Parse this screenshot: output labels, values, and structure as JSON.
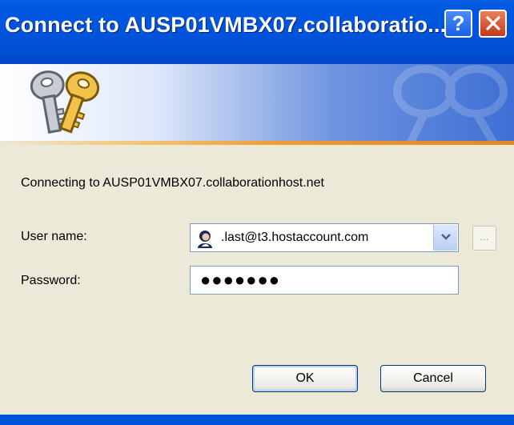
{
  "window": {
    "title": "Connect to AUSP01VMBX07.collaboratio...",
    "help_glyph": "?",
    "colors": {
      "titlebar": "#0054dc",
      "dialog_bg": "#ece9d8",
      "banner_accent": "#f29a2e"
    }
  },
  "icons": [
    "keys-icon",
    "help-icon",
    "close-icon",
    "user-avatar-icon",
    "chevron-down-icon",
    "watermark-icon"
  ],
  "body": {
    "connecting_text": "Connecting to AUSP01VMBX07.collaborationhost.net",
    "user_label": "User name:",
    "user_value": ".last@t3.hostaccount.com",
    "browse_label": "...",
    "password_label": "Password:",
    "password_mask": "●●●●●●●"
  },
  "buttons": {
    "ok": "OK",
    "cancel": "Cancel"
  }
}
